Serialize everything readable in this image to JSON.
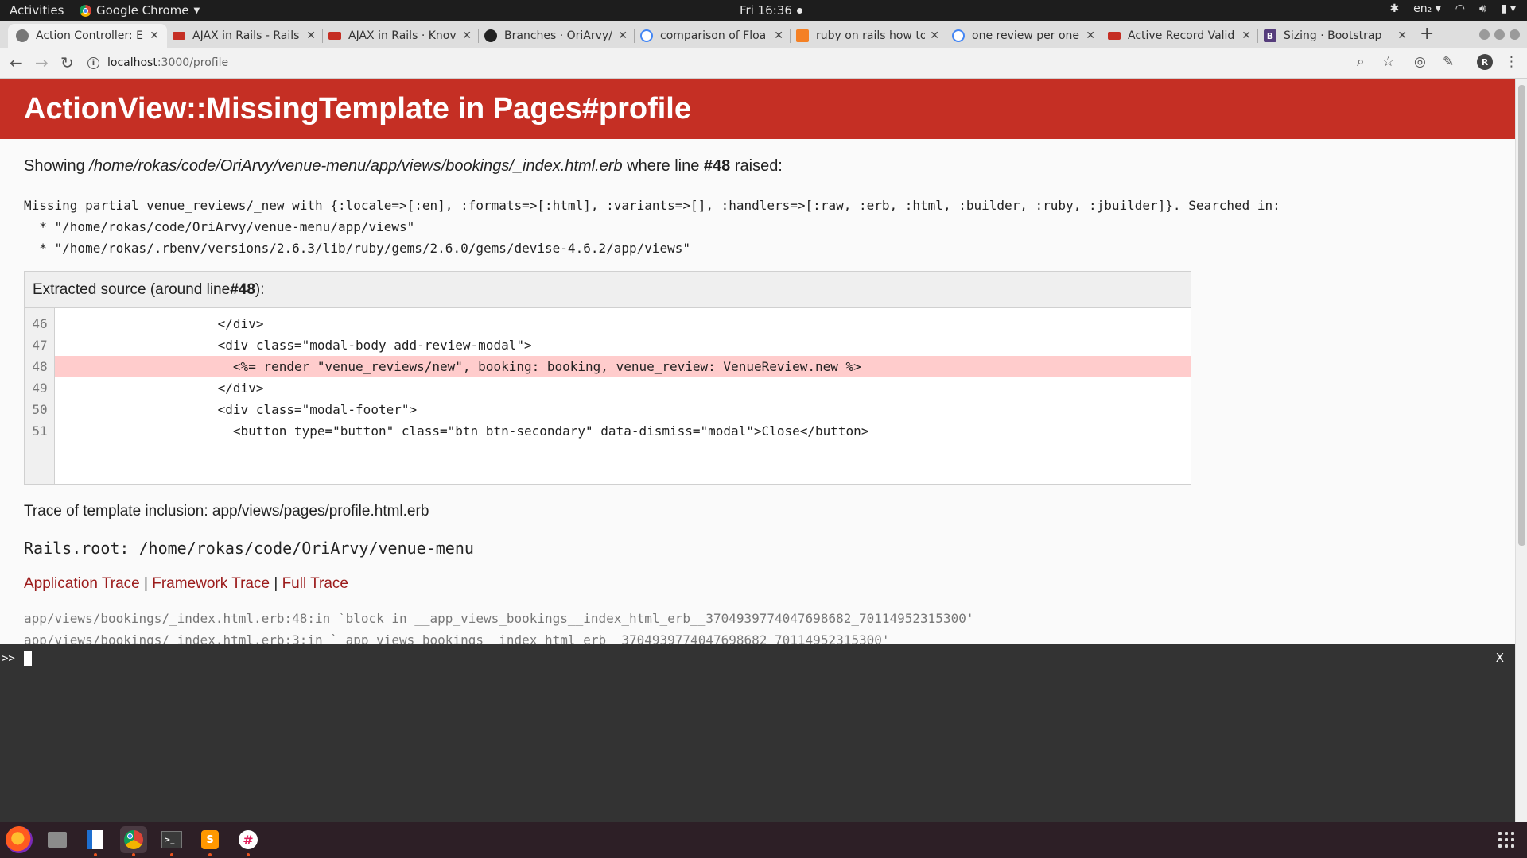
{
  "topbar": {
    "activities": "Activities",
    "app_name": "Google Chrome",
    "clock": "Fri 16:36",
    "keyboard_layout": "en₂"
  },
  "tabs": [
    {
      "title": "Action Controller: E",
      "favicon": "chrome-icon",
      "active": true
    },
    {
      "title": "AJAX in Rails - Rails",
      "favicon": "rails-icon"
    },
    {
      "title": "AJAX in Rails · Knov",
      "favicon": "rails-icon"
    },
    {
      "title": "Branches · OriArvy/",
      "favicon": "github-icon"
    },
    {
      "title": "comparison of Floa",
      "favicon": "google-icon"
    },
    {
      "title": "ruby on rails how to",
      "favicon": "stackoverflow-icon"
    },
    {
      "title": "one review per one",
      "favicon": "google-icon"
    },
    {
      "title": "Active Record Valid",
      "favicon": "rails-icon"
    },
    {
      "title": "Sizing · Bootstrap",
      "favicon": "bootstrap-icon"
    }
  ],
  "address": {
    "host": "localhost",
    "path": ":3000/profile"
  },
  "page": {
    "title": "ActionView::MissingTemplate in Pages#profile",
    "showing_prefix": "Showing ",
    "showing_file": "/home/rokas/code/OriArvy/venue-menu/app/views/bookings/_index.html.erb",
    "showing_mid": " where line ",
    "showing_line": "#48",
    "showing_suffix": " raised:",
    "error_message": "Missing partial venue_reviews/_new with {:locale=>[:en], :formats=>[:html], :variants=>[], :handlers=>[:raw, :erb, :html, :builder, :ruby, :jbuilder]}. Searched in:\n  * \"/home/rokas/code/OriArvy/venue-menu/app/views\"\n  * \"/home/rokas/.rbenv/versions/2.6.3/lib/ruby/gems/2.6.0/gems/devise-4.6.2/app/views\"",
    "extracted_prefix": "Extracted source (around line ",
    "extracted_line": "#48",
    "extracted_suffix": "):",
    "source_lines": [
      {
        "num": "46",
        "code": "                    </div>",
        "highlight": false
      },
      {
        "num": "47",
        "code": "                    <div class=\"modal-body add-review-modal\">",
        "highlight": false
      },
      {
        "num": "48",
        "code": "                      <%= render \"venue_reviews/new\", booking: booking, venue_review: VenueReview.new %>",
        "highlight": true
      },
      {
        "num": "49",
        "code": "                    </div>",
        "highlight": false
      },
      {
        "num": "50",
        "code": "                    <div class=\"modal-footer\">",
        "highlight": false
      },
      {
        "num": "51",
        "code": "                      <button type=\"button\" class=\"btn btn-secondary\" data-dismiss=\"modal\">Close</button>",
        "highlight": false
      }
    ],
    "trace_inclusion": "Trace of template inclusion: app/views/pages/profile.html.erb",
    "rails_root": "Rails.root: /home/rokas/code/OriArvy/venue-menu",
    "trace_links": [
      "Application Trace",
      "Framework Trace",
      "Full Trace"
    ],
    "trace_separator": " | ",
    "trace_entries": [
      "app/views/bookings/_index.html.erb:48:in `block in __app_views_bookings__index_html_erb__3704939774047698682_70114952315300'",
      "app/views/bookings/_index.html.erb:3:in `_app_views_bookings__index_html_erb__3704939774047698682_70114952315300'"
    ]
  },
  "console": {
    "prompt": ">>",
    "close": "X"
  },
  "dock": [
    "firefox-icon",
    "files-icon",
    "writer-icon",
    "chrome-icon",
    "terminal-icon",
    "sublime-icon",
    "slack-icon"
  ],
  "colors": {
    "error_header": "#c52f24",
    "highlight_line": "#ffcccc",
    "link": "#9b1b1b"
  }
}
